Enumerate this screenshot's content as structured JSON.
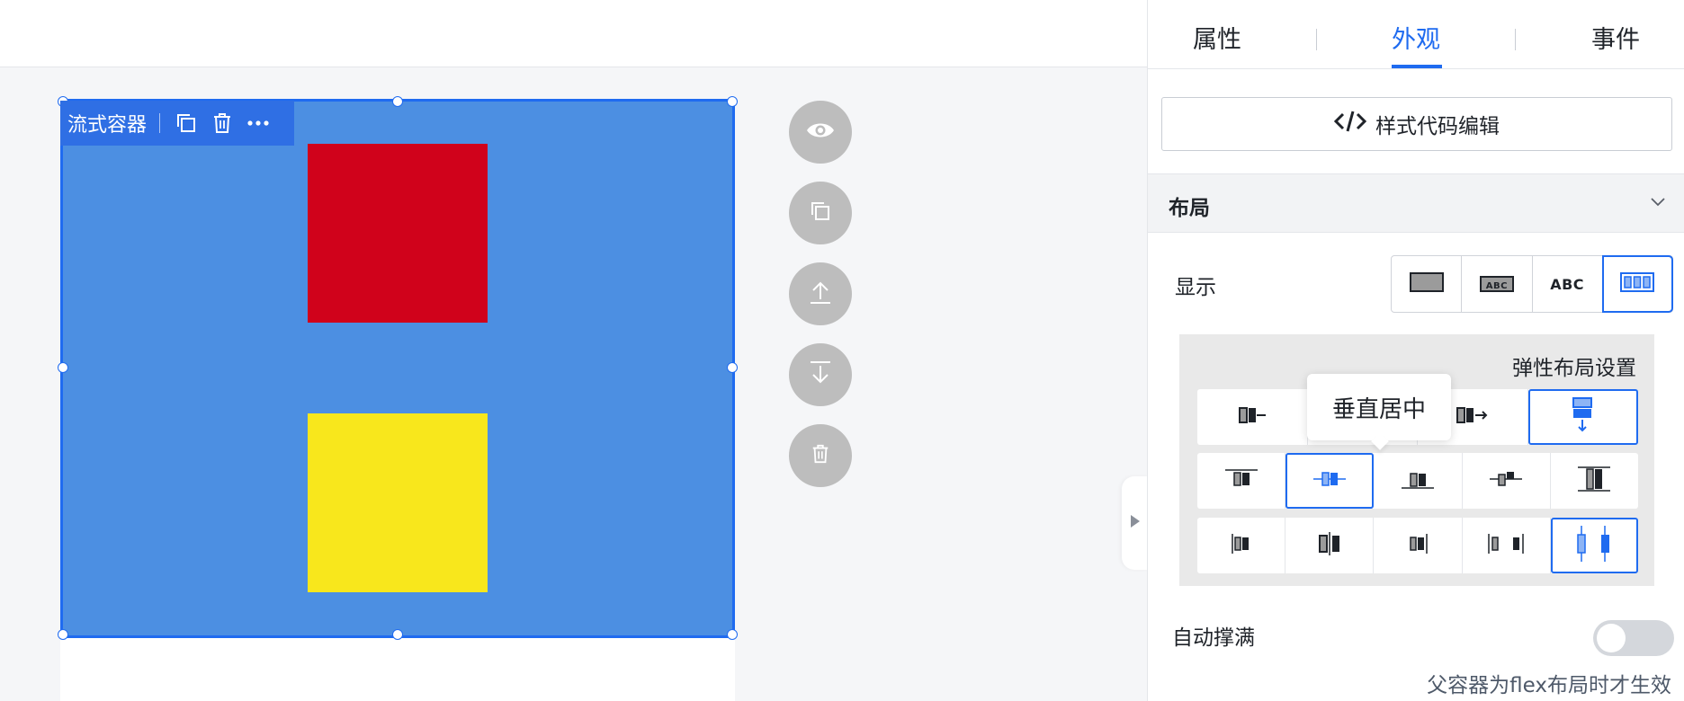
{
  "canvas": {
    "container_label": "流式容器",
    "boxes": [
      {
        "color": "#d0021b"
      },
      {
        "color": "#f8e71c"
      }
    ],
    "toolbar_icons": [
      "copy-icon",
      "trash-icon",
      "more-icon"
    ],
    "side_actions": [
      "eye-icon",
      "copy-icon",
      "move-up-icon",
      "move-down-icon",
      "trash-icon"
    ]
  },
  "panel": {
    "tabs": [
      {
        "label": "属性",
        "active": false
      },
      {
        "label": "外观",
        "active": true
      },
      {
        "label": "事件",
        "active": false
      }
    ],
    "style_code_button": "样式代码编辑",
    "layout_section": {
      "title": "布局",
      "display_label": "显示",
      "display_options": [
        "block",
        "inline-block",
        "inline",
        "flex"
      ],
      "display_abc_small": "ABC",
      "display_abc_text": "ABC",
      "display_selected": "flex",
      "flex_settings": {
        "title": "弹性布局设置",
        "tooltip": "垂直居中",
        "direction_selected": "column",
        "align_selected": "center",
        "justify_selected": "space-around"
      },
      "auto_fill_label": "自动撑满",
      "auto_fill_on": false,
      "auto_fill_hint": "父容器为flex布局时才生效"
    }
  },
  "colors": {
    "accent": "#1f6bf0",
    "container_bg": "#4c8fe2",
    "toolbar_bg": "#2f6fe4"
  }
}
